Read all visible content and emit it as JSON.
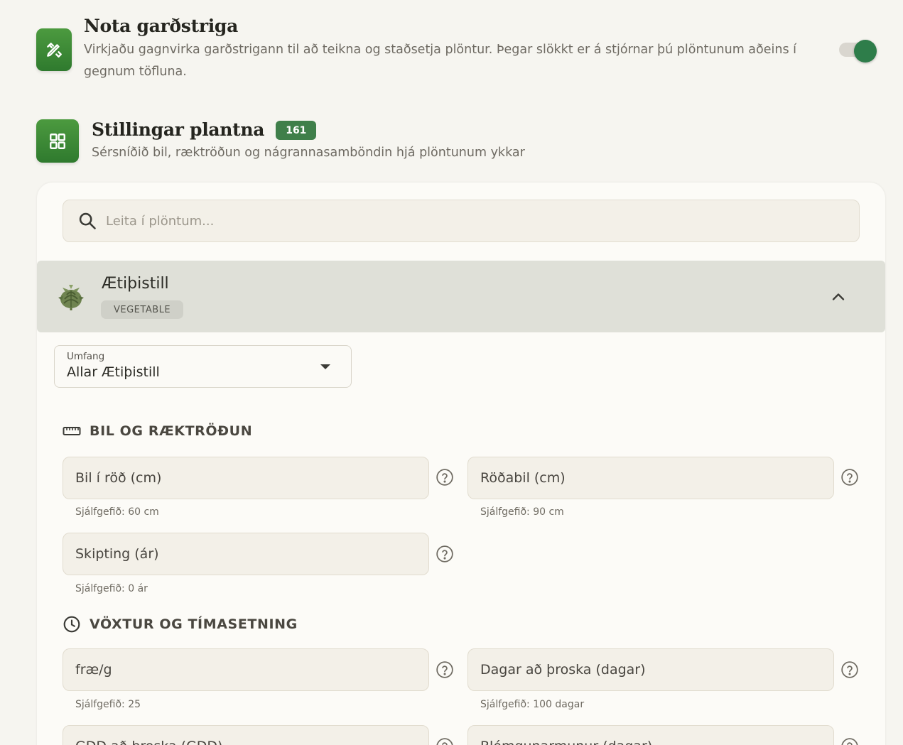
{
  "canvas_section": {
    "title": "Nota garðstriga",
    "description": "Virkjaðu gagnvirka garðstrigann til að teikna og staðsetja plöntur. Þegar slökkt er á stjórnar þú plöntunum aðeins í gegnum töfluna.",
    "enabled": true
  },
  "plants_section": {
    "title": "Stillingar plantna",
    "count": "161",
    "description": "Sérsníðið bil, ræktröðun og nágrannasamböndin hjá plöntunum ykkar"
  },
  "search": {
    "placeholder": "Leita í plöntum..."
  },
  "plant": {
    "name": "Ætiþistill",
    "type": "VEGETABLE",
    "expanded": true
  },
  "scope": {
    "label": "Umfang",
    "value": "Allar Ætiþistill"
  },
  "groups": {
    "spacing": {
      "title": "BIL OG RÆKTRÖÐUN",
      "fields": [
        {
          "placeholder": "Bil í röð (cm)",
          "hint": "Sjálfgefið: 60 cm"
        },
        {
          "placeholder": "Röðabil (cm)",
          "hint": "Sjálfgefið: 90 cm"
        },
        {
          "placeholder": "Skipting (ár)",
          "hint": "Sjálfgefið: 0 ár"
        }
      ]
    },
    "growth": {
      "title": "VÖXTUR OG TÍMASETNING",
      "fields": [
        {
          "placeholder": "fræ/g",
          "hint": "Sjálfgefið: 25"
        },
        {
          "placeholder": "Dagar að þroska (dagar)",
          "hint": "Sjálfgefið: 100 dagar"
        },
        {
          "placeholder": "GDD að þroska (GDD)",
          "hint": ""
        },
        {
          "placeholder": "Blómgunarmunur (dagar)",
          "hint": ""
        }
      ]
    }
  },
  "colors": {
    "accent": "#2e7d4a",
    "badge": "#3f7f4a",
    "icon_tile": "#3d8a36"
  },
  "icons": {
    "canvas": "pencil-ruler-icon",
    "plants": "grid-icon",
    "search": "search-icon",
    "collapse": "chevron-up-icon",
    "spacing": "ruler-icon",
    "growth": "clock-icon",
    "help": "help-circle-icon"
  }
}
